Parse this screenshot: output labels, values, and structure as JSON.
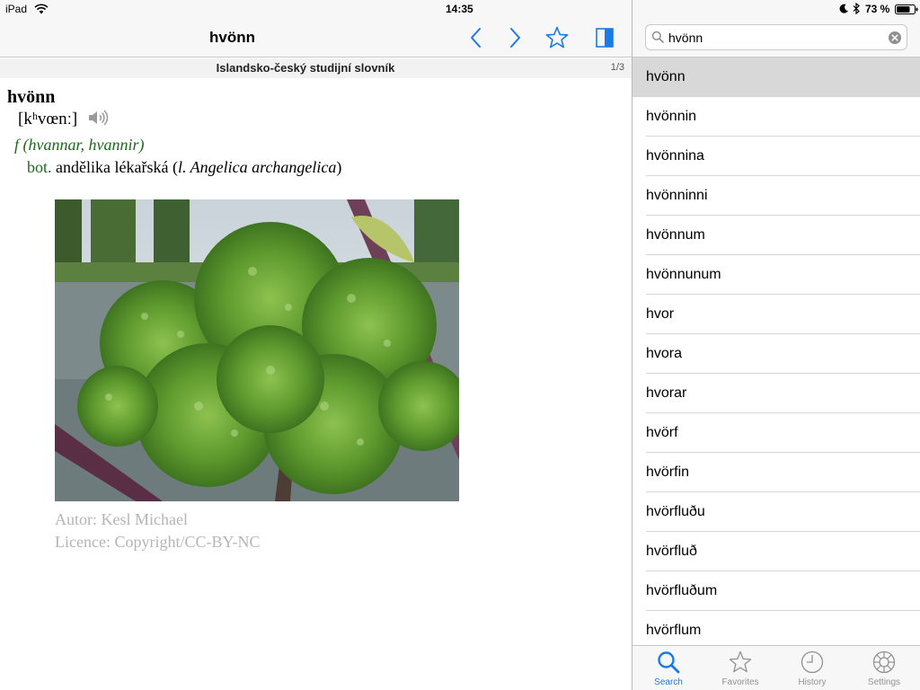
{
  "status_bar": {
    "device": "iPad",
    "time": "14:35",
    "battery": "73 %"
  },
  "navbar": {
    "title": "hvönn",
    "icons": [
      "chevron-left-icon",
      "chevron-right-icon",
      "star-icon",
      "sidebar-toggle-icon"
    ],
    "accent_color": "#1a7ae8"
  },
  "dictionary": {
    "name": "Islandsko-český studijní slovník",
    "page_indicator": "1/3"
  },
  "entry": {
    "headword": "hvönn",
    "pronunciation": "[kʰvœnː]",
    "grammar": "f (hvannar, hvannir)",
    "domain": "bot.",
    "translation": "andělika lékařská",
    "latin_open": "(",
    "latin": "l. Angelica archangelica",
    "latin_close": ")"
  },
  "image_credit": {
    "author": "Autor: Kesl Michael",
    "license": "Licence: Copyright/CC-BY-NC"
  },
  "search": {
    "value": "hvönn"
  },
  "results": [
    "hvönn",
    "hvönnin",
    "hvönnina",
    "hvönninni",
    "hvönnum",
    "hvönnunum",
    "hvor",
    "hvora",
    "hvorar",
    "hvörf",
    "hvörfin",
    "hvörfluðu",
    "hvörfluð",
    "hvörfluðum",
    "hvörflum"
  ],
  "selected_result": 0,
  "tabbar": {
    "search": "Search",
    "favorites": "Favorites",
    "history": "History",
    "settings": "Settings"
  }
}
